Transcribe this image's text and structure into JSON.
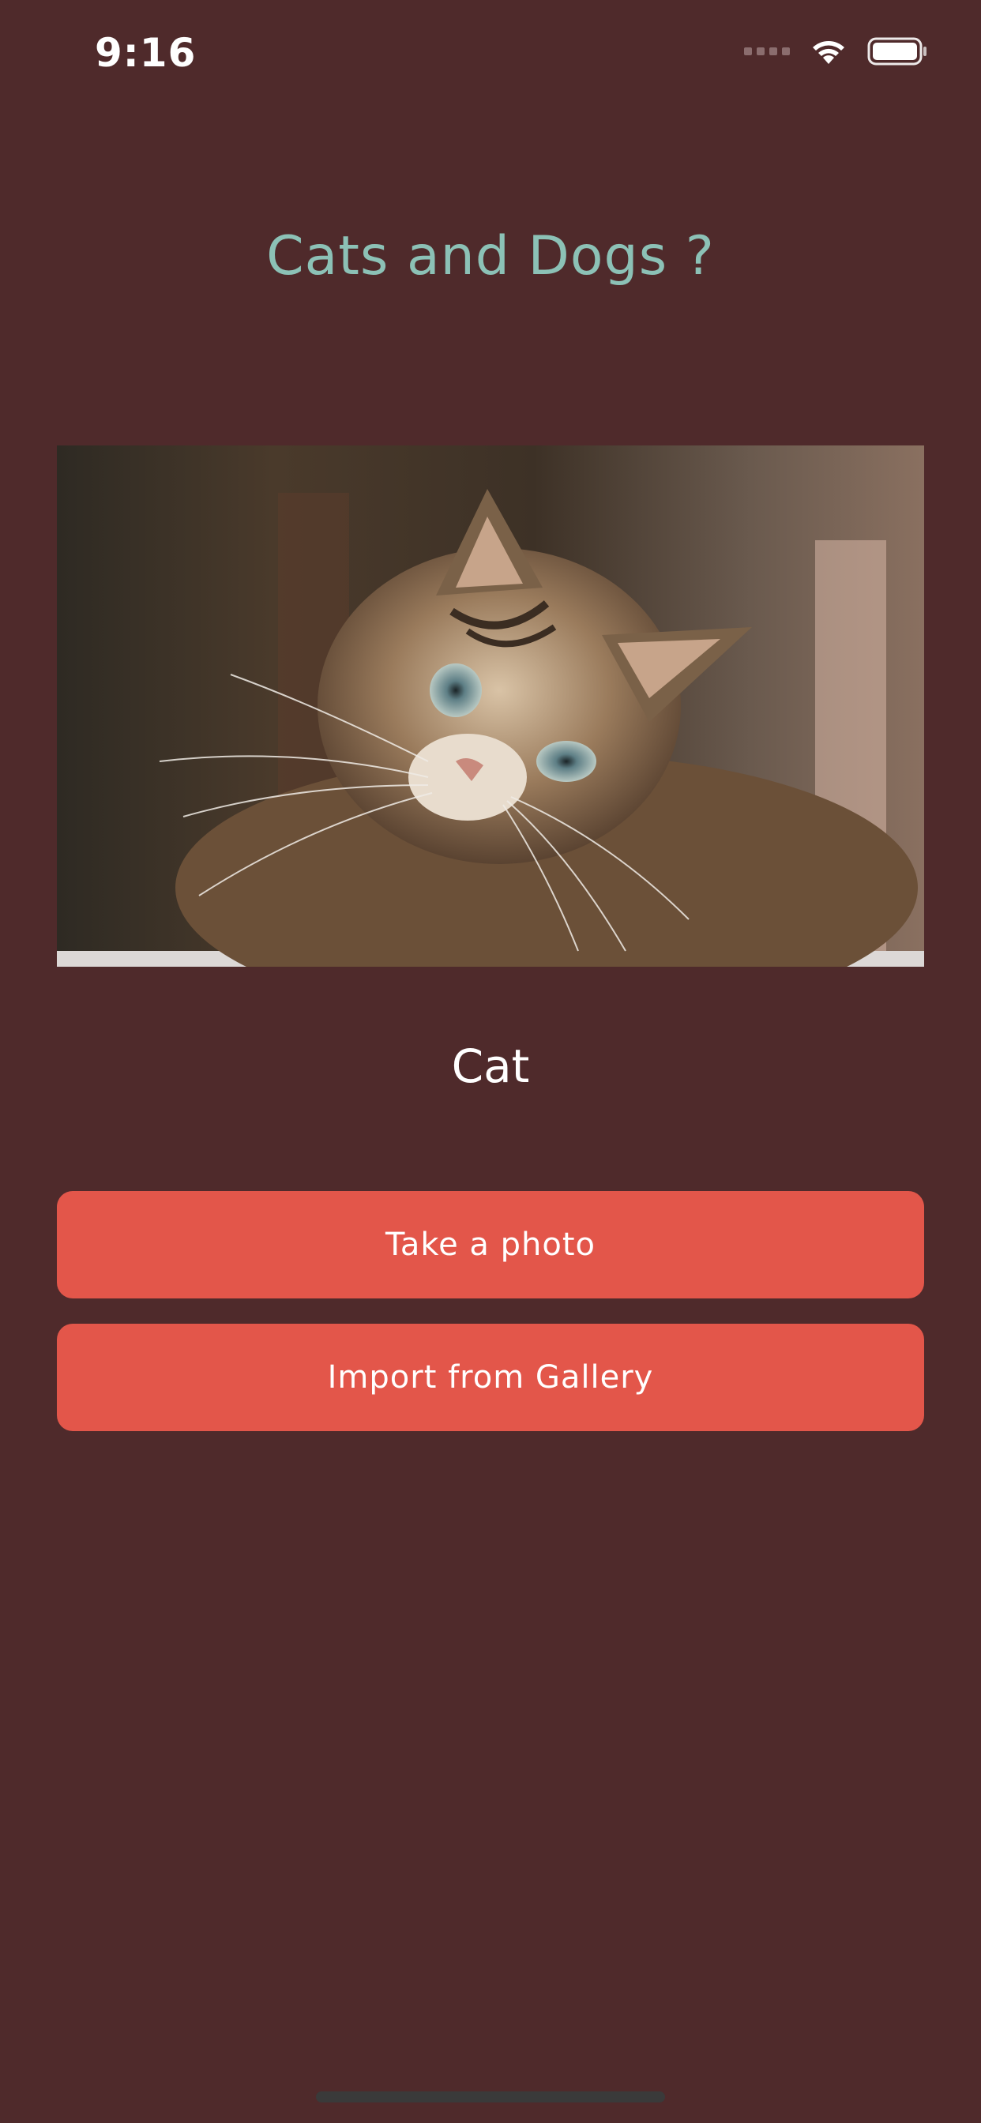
{
  "status_bar": {
    "time": "9:16",
    "icons": [
      "signal-dots-icon",
      "wifi-icon",
      "battery-icon"
    ]
  },
  "app": {
    "title": "Cats and Dogs ?"
  },
  "photo": {
    "subject": "cat-photo"
  },
  "result": {
    "label": "Cat"
  },
  "actions": {
    "take_photo_label": "Take a photo",
    "import_gallery_label": "Import from Gallery"
  },
  "colors": {
    "background": "#4f2a2b",
    "title": "#8cc1b6",
    "button": "#e3564a",
    "text": "#ffffff"
  }
}
